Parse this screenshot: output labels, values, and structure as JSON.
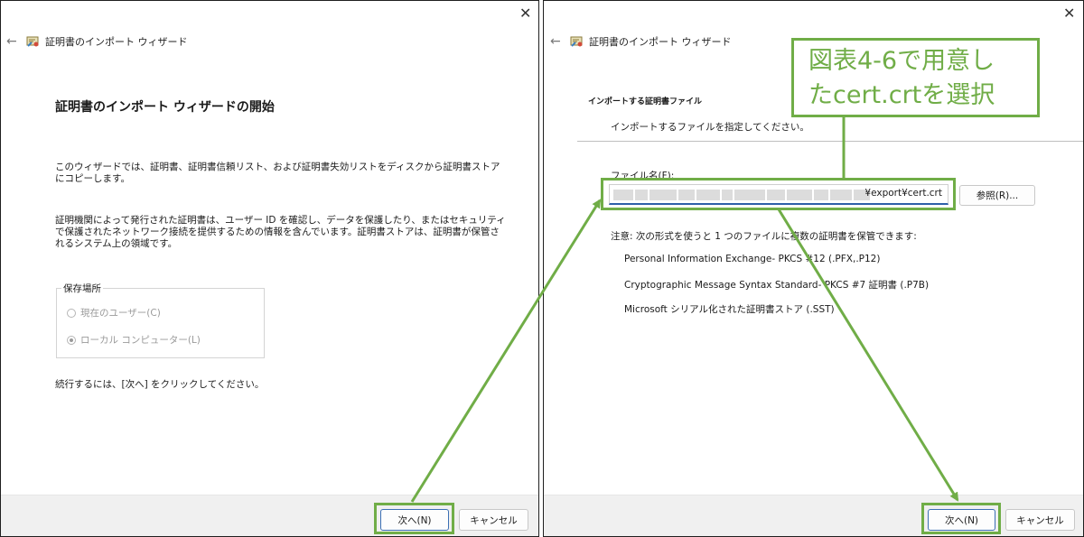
{
  "window1": {
    "title": "証明書のインポート ウィザード",
    "close": "✕",
    "back": "←",
    "heading": "証明書のインポート ウィザードの開始",
    "para1": "このウィザードでは、証明書、証明書信頼リスト、および証明書失効リストをディスクから証明書ストアにコピーします。",
    "para2": "証明機関によって発行された証明書は、ユーザー ID を確認し、データを保護したり、またはセキュリティで保護されたネットワーク接続を提供するための情報を含んでいます。証明書ストアは、証明書が保管されるシステム上の領域です。",
    "store_group_label": "保存場所",
    "radio_current_user": "現在のユーザー(C)",
    "radio_local_machine": "ローカル コンピューター(L)",
    "continue_text": "続行するには、[次へ] をクリックしてください。",
    "next_button": "次へ(N)",
    "cancel_button": "キャンセル"
  },
  "window2": {
    "title": "証明書のインポート ウィザード",
    "close": "✕",
    "back": "←",
    "section_title": "インポートする証明書ファイル",
    "section_desc": "インポートするファイルを指定してください。",
    "filename_label": "ファイル名(F):",
    "filename_value": "¥export¥cert.crt",
    "browse_button": "参照(R)...",
    "note": "注意: 次の形式を使うと 1 つのファイルに複数の証明書を保管できます:",
    "formats": [
      "Personal Information Exchange- PKCS #12 (.PFX,.P12)",
      "Cryptographic Message Syntax Standard- PKCS #7 証明書 (.P7B)",
      "Microsoft シリアル化された証明書ストア (.SST)"
    ],
    "next_button": "次へ(N)",
    "cancel_button": "キャンセル"
  },
  "callout": {
    "line1": "図表4-6で用意し",
    "line2": "たcert.crtを選択"
  },
  "colors": {
    "highlight": "#70ad47",
    "primary_border": "#3c6fb4"
  }
}
